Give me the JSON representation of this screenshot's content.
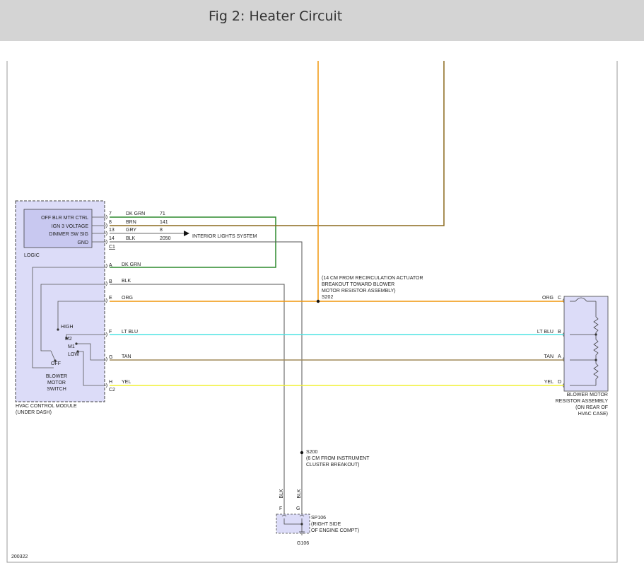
{
  "title": "Fig 2: Heater Circuit",
  "colors": {
    "dk_grn": "#2d8a2d",
    "brn": "#8b6a1e",
    "gry": "#888888",
    "blk": "#555555",
    "org": "#f0960a",
    "lt_blu": "#4fe3e3",
    "tan": "#a08a58",
    "yel": "#f0f032",
    "module_fill": "#dcdcf8"
  },
  "hvac_module": {
    "logic_inputs": [
      "OFF BLR MTR CTRL",
      "IGN 3 VOLTAGE",
      "DIMMER SW SIG",
      "GND"
    ],
    "logic_label": "LOGIC",
    "name_line1": "HVAC CONTROL MODULE",
    "name_line2": "(UNDER DASH)"
  },
  "c1_pins": [
    {
      "pin": "7",
      "color": "DK GRN",
      "circuit": "71"
    },
    {
      "pin": "8",
      "color": "BRN",
      "circuit": "141"
    },
    {
      "pin": "13",
      "color": "GRY",
      "circuit": "8"
    },
    {
      "pin": "14",
      "color": "BLK",
      "circuit": "2050"
    }
  ],
  "connector_c1": "C1",
  "connector_c2": "C2",
  "c2_pins": [
    {
      "pin": "A",
      "color": "DK GRN"
    },
    {
      "pin": "B",
      "color": "BLK"
    },
    {
      "pin": "E",
      "color": "ORG"
    },
    {
      "pin": "F",
      "color": "LT BLU"
    },
    {
      "pin": "G",
      "color": "TAN"
    },
    {
      "pin": "H",
      "color": "YEL"
    }
  ],
  "switch": {
    "positions": [
      "HIGH",
      "M2",
      "M1",
      "LOW",
      "OFF"
    ],
    "name": [
      "BLOWER",
      "MOTOR",
      "SWITCH"
    ]
  },
  "interior_lights": "INTERIOR LIGHTS SYSTEM",
  "s202": {
    "note": [
      "(14 CM FROM RECIRCULATION ACTUATOR",
      "BREAKOUT TOWARD BLOWER",
      "MOTOR RESISTOR ASSEMBLY)"
    ],
    "label": "S202"
  },
  "resistor_pins": [
    {
      "color": "ORG",
      "pin": "C"
    },
    {
      "color": "LT BLU",
      "pin": "B"
    },
    {
      "color": "TAN",
      "pin": "A"
    },
    {
      "color": "YEL",
      "pin": "D"
    }
  ],
  "resistor_name": [
    "BLOWER MOTOR",
    "RESISTOR ASSEMBLY",
    "(ON REAR OF",
    "HVAC CASE)"
  ],
  "s200": {
    "label": "S200",
    "note": [
      "(6 CM FROM INSTRUMENT",
      "CLUSTER BREAKOUT)"
    ]
  },
  "ground": {
    "wire_left": "BLK",
    "wire_right": "BLK",
    "pin_left": "F",
    "pin_right": "G",
    "splice": [
      "SP106",
      "(RIGHT SIDE",
      "OF ENGINE COMPT)"
    ],
    "ground_id": "G106"
  },
  "diagram_id": "200322"
}
